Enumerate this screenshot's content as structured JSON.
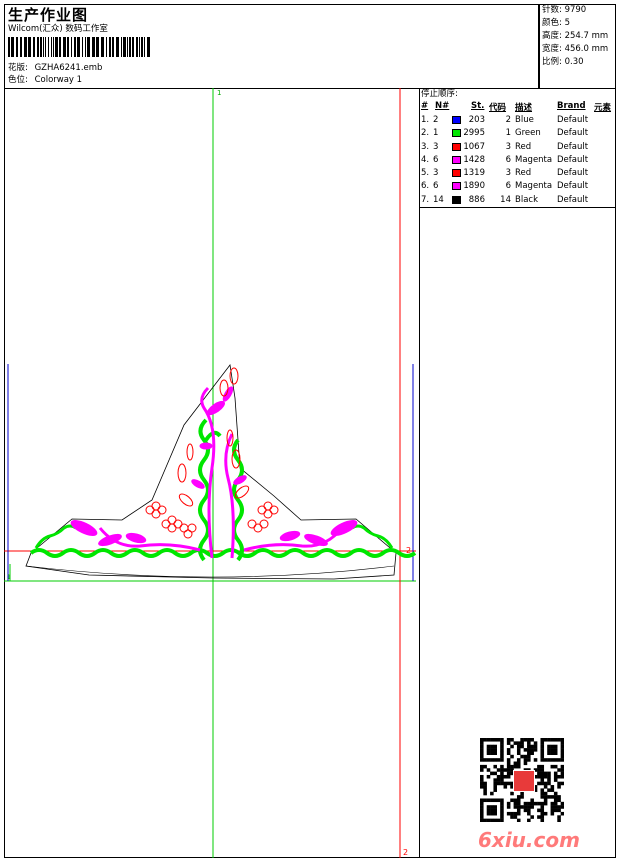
{
  "header": {
    "title": "生产作业图",
    "company": "Wilcom(汇众) 数码工作室",
    "design_label": "花版:",
    "design_value": "GZHA6241.emb",
    "colorway_label": "色位:",
    "colorway_value": "Colorway 1"
  },
  "stats": [
    {
      "label": "针数:",
      "value": "9790"
    },
    {
      "label": "颜色:",
      "value": "5"
    },
    {
      "label": "高度:",
      "value": "254.7 mm"
    },
    {
      "label": "宽度:",
      "value": "456.0 mm"
    },
    {
      "label": "比例:",
      "value": "0.30"
    }
  ],
  "stop_sequence": {
    "title": "停止顺序:",
    "columns": [
      "#",
      "N#",
      "St.",
      "代码",
      "描述",
      "Brand",
      "元素"
    ],
    "rows": [
      {
        "seq": "1.",
        "n": "2",
        "color": "#0000ff",
        "st": "203",
        "code": "2",
        "desc": "Blue",
        "brand": "Default"
      },
      {
        "seq": "2.",
        "n": "1",
        "color": "#00e600",
        "st": "2995",
        "code": "1",
        "desc": "Green",
        "brand": "Default"
      },
      {
        "seq": "3.",
        "n": "3",
        "color": "#ff0000",
        "st": "1067",
        "code": "3",
        "desc": "Red",
        "brand": "Default"
      },
      {
        "seq": "4.",
        "n": "6",
        "color": "#ff00ff",
        "st": "1428",
        "code": "6",
        "desc": "Magenta",
        "brand": "Default"
      },
      {
        "seq": "5.",
        "n": "3",
        "color": "#ff0000",
        "st": "1319",
        "code": "3",
        "desc": "Red",
        "brand": "Default"
      },
      {
        "seq": "6.",
        "n": "6",
        "color": "#ff00ff",
        "st": "1890",
        "code": "6",
        "desc": "Magenta",
        "brand": "Default"
      },
      {
        "seq": "7.",
        "n": "14",
        "color": "#000000",
        "st": "886",
        "code": "14",
        "desc": "Black",
        "brand": "Default"
      }
    ]
  },
  "guides": {
    "top_marker": "1",
    "right_marker": "2",
    "bottom_marker": "2",
    "left_marker": "1"
  },
  "watermark": "6xiu.com",
  "colors": {
    "guide_green": "#00cc00",
    "guide_red": "#ff0000",
    "guide_blue": "#0000cc",
    "watermark": "#ff7a7a"
  }
}
